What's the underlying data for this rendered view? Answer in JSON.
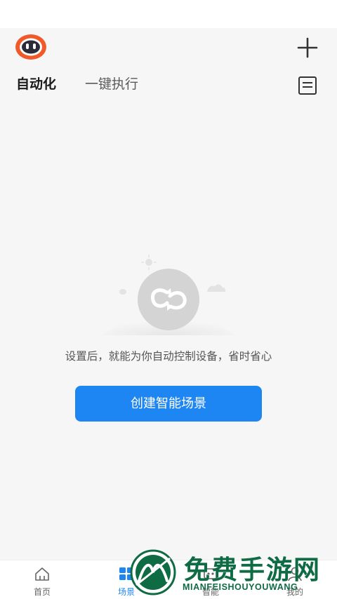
{
  "tabs": [
    {
      "label": "自动化",
      "active": true
    },
    {
      "label": "一键执行",
      "active": false
    }
  ],
  "icons": {
    "avatar": "robot-avatar-icon",
    "add": "plus-icon",
    "log": "document-list-icon",
    "empty": "loop-cloud-illustration"
  },
  "empty_state": {
    "message": "设置后，就能为你自动控制设备，省时省心",
    "button_label": "创建智能场景"
  },
  "bottom_nav": [
    {
      "label": "首页",
      "icon": "home-icon",
      "active": false
    },
    {
      "label": "场景",
      "icon": "scene-grid-icon",
      "active": true
    },
    {
      "label": "智能",
      "icon": "smart-icon",
      "active": false
    },
    {
      "label": "我的",
      "icon": "profile-icon",
      "active": false
    }
  ],
  "watermark": {
    "title": "免费手游网",
    "subtitle": "MIANFEISHOUYOUWANG"
  },
  "colors": {
    "accent": "#1e86f3",
    "background": "#f6f6f6",
    "watermark": "#0f6b44",
    "avatar_orange": "#f05a2a"
  }
}
